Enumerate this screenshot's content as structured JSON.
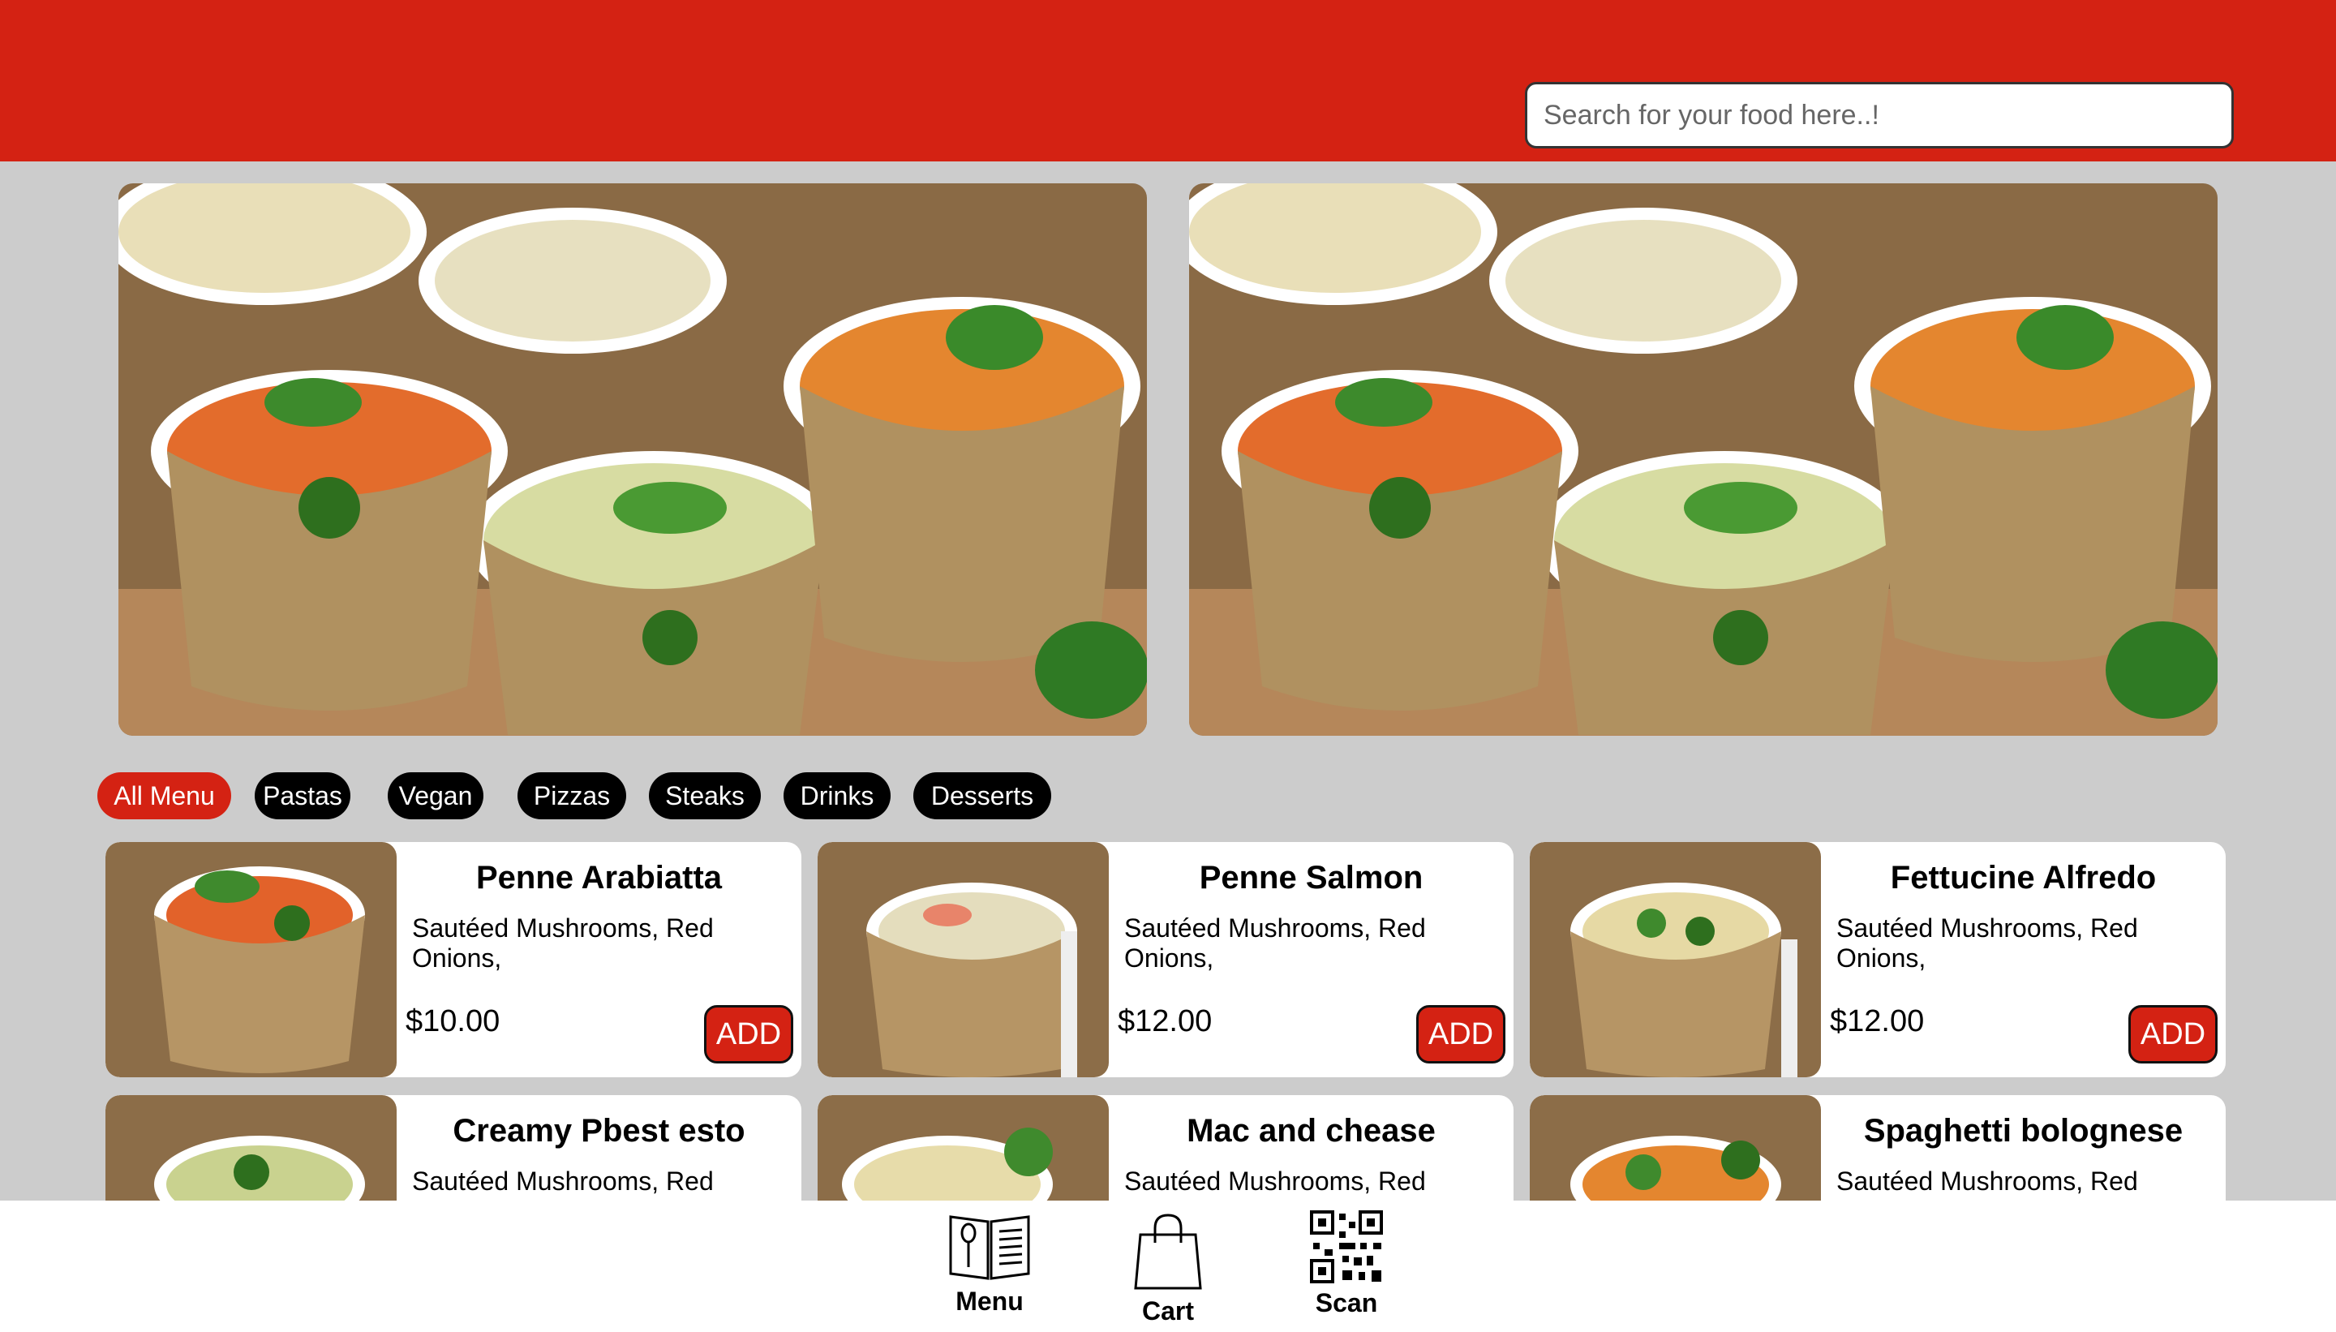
{
  "search": {
    "placeholder": "Search for your food here..!"
  },
  "categories": [
    "All Menu",
    "Pastas",
    "Vegan",
    "Pizzas",
    "Steaks",
    "Drinks",
    "Desserts"
  ],
  "active_category": "All Menu",
  "items": [
    {
      "name": "Penne Arabiatta",
      "description": "Sautéed Mushrooms, Red Onions,",
      "price": "$10.00",
      "add_label": "ADD"
    },
    {
      "name": "Penne Salmon",
      "description": "Sautéed Mushrooms, Red Onions,",
      "price": "$12.00",
      "add_label": "ADD"
    },
    {
      "name": "Fettucine Alfredo",
      "description": "Sautéed Mushrooms, Red Onions,",
      "price": "$12.00",
      "add_label": "ADD"
    },
    {
      "name": "Creamy Pbest esto",
      "description": "Sautéed Mushrooms, Red",
      "price": "",
      "add_label": ""
    },
    {
      "name": "Mac and chease",
      "description": "Sautéed Mushrooms, Red",
      "price": "",
      "add_label": ""
    },
    {
      "name": "Spaghetti bolognese",
      "description": "Sautéed Mushrooms, Red",
      "price": "",
      "add_label": ""
    }
  ],
  "nav": {
    "menu": "Menu",
    "cart": "Cart",
    "scan": "Scan"
  },
  "colors": {
    "brand": "#d42213",
    "background": "#cccccc",
    "chip": "#000000"
  }
}
